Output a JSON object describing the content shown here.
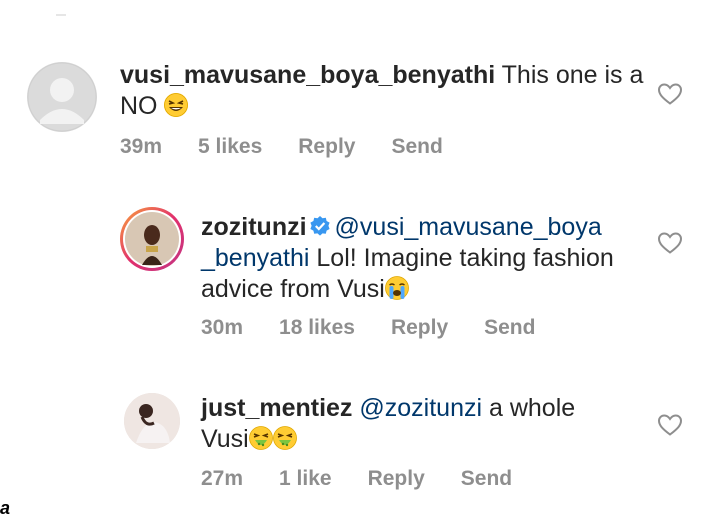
{
  "comments": [
    {
      "username": "vusi_mavusane_boya_benyathi",
      "text_line1": " This one is a",
      "text_line2": "NO ",
      "emoji": "grinning-squint-emoji",
      "time": "39m",
      "likes": "5 likes",
      "reply": "Reply",
      "send": "Send"
    },
    {
      "username": "zozitunzi",
      "mention_part1": "@vusi_mavusane_boya",
      "mention_part2": "_benyathi",
      "text_line2": " Lol! Imagine taking fashion",
      "text_line3": "advice from Vusi",
      "emoji": "crying-emoji",
      "time": "30m",
      "likes": "18 likes",
      "reply": "Reply",
      "send": "Send"
    },
    {
      "username": "just_mentiez",
      "mention": "@zozitunzi",
      "text_line1": " a whole",
      "text_line2": "Vusi",
      "emoji": "vomiting-face-emoji",
      "time": "27m",
      "likes": "1 like",
      "reply": "Reply",
      "send": "Send"
    }
  ],
  "colors": {
    "text": "#262626",
    "meta": "#8e8e8e",
    "mention": "#00376b",
    "verified": "#3897f0"
  },
  "corner_mark": "a"
}
